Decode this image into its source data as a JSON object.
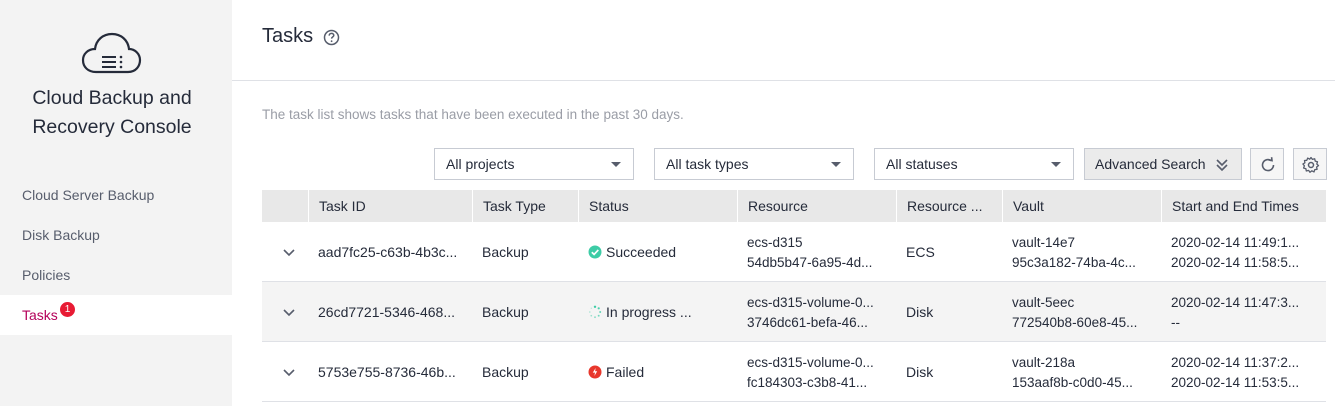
{
  "sidebar": {
    "title_line1": "Cloud Backup and",
    "title_line2": "Recovery Console",
    "items": [
      {
        "label": "Cloud Server Backup"
      },
      {
        "label": "Disk Backup"
      },
      {
        "label": "Policies"
      },
      {
        "label": "Tasks",
        "badge": "1",
        "active": true
      }
    ]
  },
  "header": {
    "title": "Tasks"
  },
  "hint": "The task list shows tasks that have been executed in the past 30 days.",
  "filters": {
    "project": "All projects",
    "task_type": "All task types",
    "status": "All statuses",
    "advanced_search": "Advanced Search"
  },
  "table": {
    "columns": [
      "Task ID",
      "Task Type",
      "Status",
      "Resource",
      "Resource ...",
      "Vault",
      "Start and End Times"
    ],
    "rows": [
      {
        "task_id": "aad7fc25-c63b-4b3c...",
        "task_type": "Backup",
        "status": "Succeeded",
        "status_icon": "success-icon",
        "resource_line1": "ecs-d315",
        "resource_line2": "54db5b47-6a95-4d...",
        "resource_type": "ECS",
        "vault_line1": "vault-14e7",
        "vault_line2": "95c3a182-74ba-4c...",
        "time_line1": "2020-02-14 11:49:1...",
        "time_line2": "2020-02-14 11:58:5..."
      },
      {
        "task_id": "26cd7721-5346-468...",
        "task_type": "Backup",
        "status": "In progress ...",
        "status_icon": "loading-icon",
        "resource_line1": "ecs-d315-volume-0...",
        "resource_line2": "3746dc61-befa-46...",
        "resource_type": "Disk",
        "vault_line1": "vault-5eec",
        "vault_line2": "772540b8-60e8-45...",
        "time_line1": "2020-02-14 11:47:3...",
        "time_line2": "--"
      },
      {
        "task_id": "5753e755-8736-46b...",
        "task_type": "Backup",
        "status": "Failed",
        "status_icon": "failed-icon",
        "resource_line1": "ecs-d315-volume-0...",
        "resource_line2": "fc184303-c3b8-41...",
        "resource_type": "Disk",
        "vault_line1": "vault-218a",
        "vault_line2": "153aaf8b-c0d0-45...",
        "time_line1": "2020-02-14 11:37:2...",
        "time_line2": "2020-02-14 11:53:5..."
      }
    ]
  },
  "colors": {
    "accent": "#b4005a",
    "badge": "#e81b34",
    "success": "#3dcca6",
    "failed": "#e8372c",
    "progress": "#3dcca6"
  }
}
